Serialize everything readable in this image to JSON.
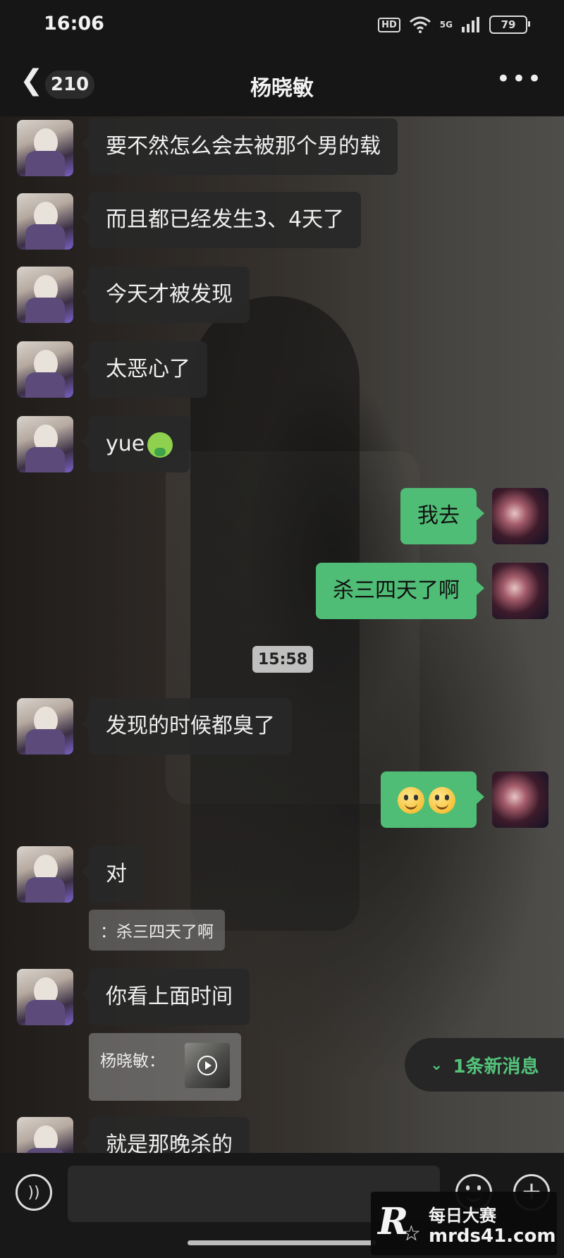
{
  "status_bar": {
    "time": "16:06",
    "hd": "HD",
    "network": "5G",
    "battery": "79"
  },
  "header": {
    "back_icon": "chevron-left-icon",
    "unread_count": "210",
    "title": "杨晓敏",
    "more_icon": "more-dots-icon"
  },
  "messages": [
    {
      "side": "left",
      "text": "要不然怎么会去被那个男的载"
    },
    {
      "side": "left",
      "text": "而且都已经发生3、4天了"
    },
    {
      "side": "left",
      "text": "今天才被发现"
    },
    {
      "side": "left",
      "text": "太恶心了"
    },
    {
      "side": "left",
      "text": "yue",
      "emoji": "nauseated-face-icon"
    },
    {
      "side": "right",
      "text": "我去"
    },
    {
      "side": "right",
      "text": "杀三四天了啊"
    },
    {
      "side": "left",
      "text": "发现的时候都臭了"
    },
    {
      "side": "right",
      "text": "",
      "emoji": "smiley-face-icon x2"
    },
    {
      "side": "left",
      "text": "对"
    },
    {
      "side": "left",
      "text": "你看上面时间"
    },
    {
      "side": "left",
      "text": "就是那晚杀的"
    }
  ],
  "timestamp": "15:58",
  "quotes": {
    "reply_quote": "：杀三四天了啊",
    "video_quote_label": "杨晓敏："
  },
  "new_message_pill": {
    "text": "1条新消息",
    "icon": "double-chevron-down-icon"
  },
  "input_bar": {
    "voice_icon": "voice-icon",
    "emoji_icon": "emoji-icon",
    "plus_icon": "plus-icon"
  },
  "watermark": {
    "logo": "R",
    "name": "每日大赛",
    "url": "mrds41.com"
  },
  "colors": {
    "bubble_green": "#4fbd75",
    "bubble_dark": "#282828",
    "new_msg_green": "#53c37b",
    "bar_bg": "#161616"
  }
}
